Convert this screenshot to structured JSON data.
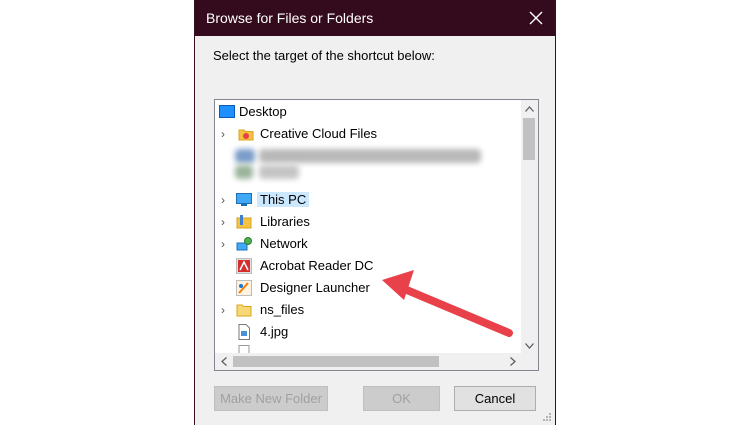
{
  "window": {
    "title": "Browse for Files or Folders"
  },
  "prompt": "Select the target of the shortcut below:",
  "tree": {
    "items": [
      {
        "label": "Desktop",
        "icon": "desktop-icon",
        "expandable": false,
        "selected": false
      },
      {
        "label": "Creative Cloud Files",
        "icon": "cloud-folder-icon",
        "expandable": true,
        "selected": false
      },
      {
        "label": "This PC",
        "icon": "computer-icon",
        "expandable": true,
        "selected": true
      },
      {
        "label": "Libraries",
        "icon": "libraries-icon",
        "expandable": true,
        "selected": false
      },
      {
        "label": "Network",
        "icon": "network-icon",
        "expandable": true,
        "selected": false
      },
      {
        "label": "Acrobat Reader DC",
        "icon": "acrobat-icon",
        "expandable": false,
        "selected": false
      },
      {
        "label": "Designer Launcher",
        "icon": "designer-launcher-icon",
        "expandable": false,
        "selected": false
      },
      {
        "label": "ns_files",
        "icon": "folder-icon",
        "expandable": true,
        "selected": false
      },
      {
        "label": "4.jpg",
        "icon": "image-file-icon",
        "expandable": false,
        "selected": false
      }
    ]
  },
  "buttons": {
    "new_folder": "Make New Folder",
    "ok": "OK",
    "cancel": "Cancel"
  },
  "colors": {
    "titlebar": "#340b1c",
    "selection": "#cce8ff",
    "annotation_arrow": "#e8414a"
  }
}
